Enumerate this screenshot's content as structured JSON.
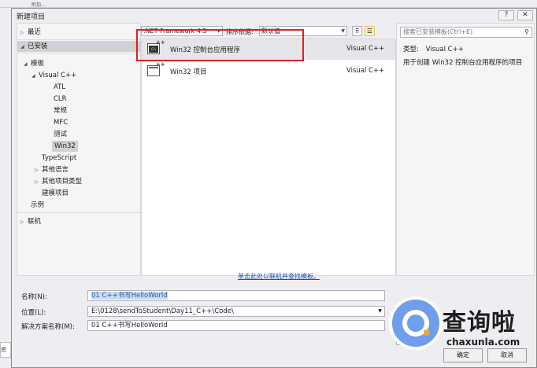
{
  "ide": {
    "toolbar_item": "附加..."
  },
  "dialog": {
    "title": "新建项目",
    "help_label": "?",
    "close_label": "✕"
  },
  "tree": {
    "recent": "最近",
    "installed": "已安装",
    "templates": "模板",
    "visual_cpp": "Visual C++",
    "children": [
      "ATL",
      "CLR",
      "常规",
      "MFC",
      "测试",
      "Win32"
    ],
    "typescript": "TypeScript",
    "other_languages": "其他语言",
    "other_project_types": "其他项目类型",
    "modeling": "建模项目",
    "samples": "示例",
    "online": "联机"
  },
  "filter": {
    "framework": ".NET Framework 4.5",
    "sort_label": "排序依据:",
    "sort_value": "默认值"
  },
  "templates": [
    {
      "name": "Win32 控制台应用程序",
      "lang": "Visual C++",
      "icon": "console-app-icon"
    },
    {
      "name": "Win32 项目",
      "lang": "Visual C++",
      "icon": "win32-project-icon"
    }
  ],
  "online_link": "单击此处以联机并查找模板。",
  "details": {
    "search_placeholder": "搜索已安装模板(Ctrl+E)",
    "type_label": "类型:",
    "type_value": "Visual C++",
    "description": "用于创建 Win32 控制台应用程序的项目"
  },
  "form": {
    "name_label": "名称(N):",
    "name_value": "01 C++书写HelloWorld",
    "location_label": "位置(L):",
    "location_value": "E:\\0128\\sendToStudent\\Day11_C++\\Code\\",
    "solution_label": "解决方案名称(M):",
    "solution_value": "01 C++书写HelloWorld"
  },
  "buttons": {
    "ok": "确定",
    "cancel": "取消"
  },
  "watermark": {
    "text": "查询啦",
    "url": "chaxunla.com"
  },
  "colors": {
    "highlight_box": "#e02020",
    "link": "#1a50b8"
  }
}
